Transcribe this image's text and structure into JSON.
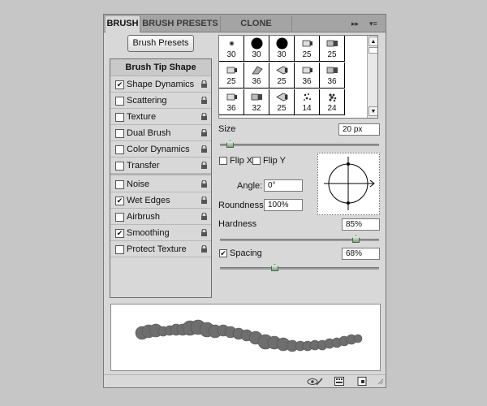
{
  "tabs": [
    {
      "label": "BRUSH",
      "active": true
    },
    {
      "label": "BRUSH PRESETS",
      "active": false
    },
    {
      "label": "CLONE SOURCE",
      "active": false
    }
  ],
  "panel_menu": {
    "collapse": "▸▸",
    "menu": "▾≡"
  },
  "brush_presets_button": "Brush Presets",
  "options": {
    "header": "Brush Tip Shape",
    "items": [
      {
        "label": "Shape Dynamics",
        "checked": true,
        "lock": true
      },
      {
        "label": "Scattering",
        "checked": false,
        "lock": true
      },
      {
        "label": "Texture",
        "checked": false,
        "lock": true
      },
      {
        "label": "Dual Brush",
        "checked": false,
        "lock": true
      },
      {
        "label": "Color Dynamics",
        "checked": false,
        "lock": true
      },
      {
        "label": "Transfer",
        "checked": false,
        "lock": true
      },
      {
        "label": "Noise",
        "checked": false,
        "lock": true
      },
      {
        "label": "Wet Edges",
        "checked": true,
        "lock": true
      },
      {
        "label": "Airbrush",
        "checked": false,
        "lock": true
      },
      {
        "label": "Smoothing",
        "checked": true,
        "lock": true
      },
      {
        "label": "Protect Texture",
        "checked": false,
        "lock": true
      }
    ]
  },
  "brush_tips": [
    {
      "size": "30",
      "shape": "soft-dot"
    },
    {
      "size": "30",
      "shape": "hard-round"
    },
    {
      "size": "30",
      "shape": "hard-round"
    },
    {
      "size": "25",
      "shape": "bristle-side"
    },
    {
      "size": "25",
      "shape": "bristle-flat"
    },
    {
      "size": "25",
      "shape": "bristle-side"
    },
    {
      "size": "36",
      "shape": "bristle-fan"
    },
    {
      "size": "25",
      "shape": "bristle-cone"
    },
    {
      "size": "36",
      "shape": "bristle-side"
    },
    {
      "size": "36",
      "shape": "bristle-flat"
    },
    {
      "size": "36",
      "shape": "bristle-side"
    },
    {
      "size": "32",
      "shape": "bristle-flat"
    },
    {
      "size": "25",
      "shape": "bristle-cone"
    },
    {
      "size": "14",
      "shape": "scatter"
    },
    {
      "size": "24",
      "shape": "scatter-dense"
    }
  ],
  "size": {
    "label": "Size",
    "value": "20 px",
    "level": 0.06
  },
  "flip_x": {
    "label": "Flip X",
    "checked": false
  },
  "flip_y": {
    "label": "Flip Y",
    "checked": false
  },
  "angle": {
    "label": "Angle:",
    "value": "0°"
  },
  "roundness": {
    "label": "Roundness:",
    "value": "100%"
  },
  "hardness": {
    "label": "Hardness",
    "value": "85%",
    "level": 0.85
  },
  "spacing": {
    "label": "Spacing",
    "value": "68%",
    "checked": true,
    "level": 0.34
  },
  "icons": {
    "lock": "lock-icon",
    "eye_brush": "eye-brush-icon",
    "grid": "grid-icon",
    "new": "new-preset-icon"
  },
  "colors": {
    "accent_thumb": "#7fa07f",
    "stroke": "#6e6e6e"
  }
}
